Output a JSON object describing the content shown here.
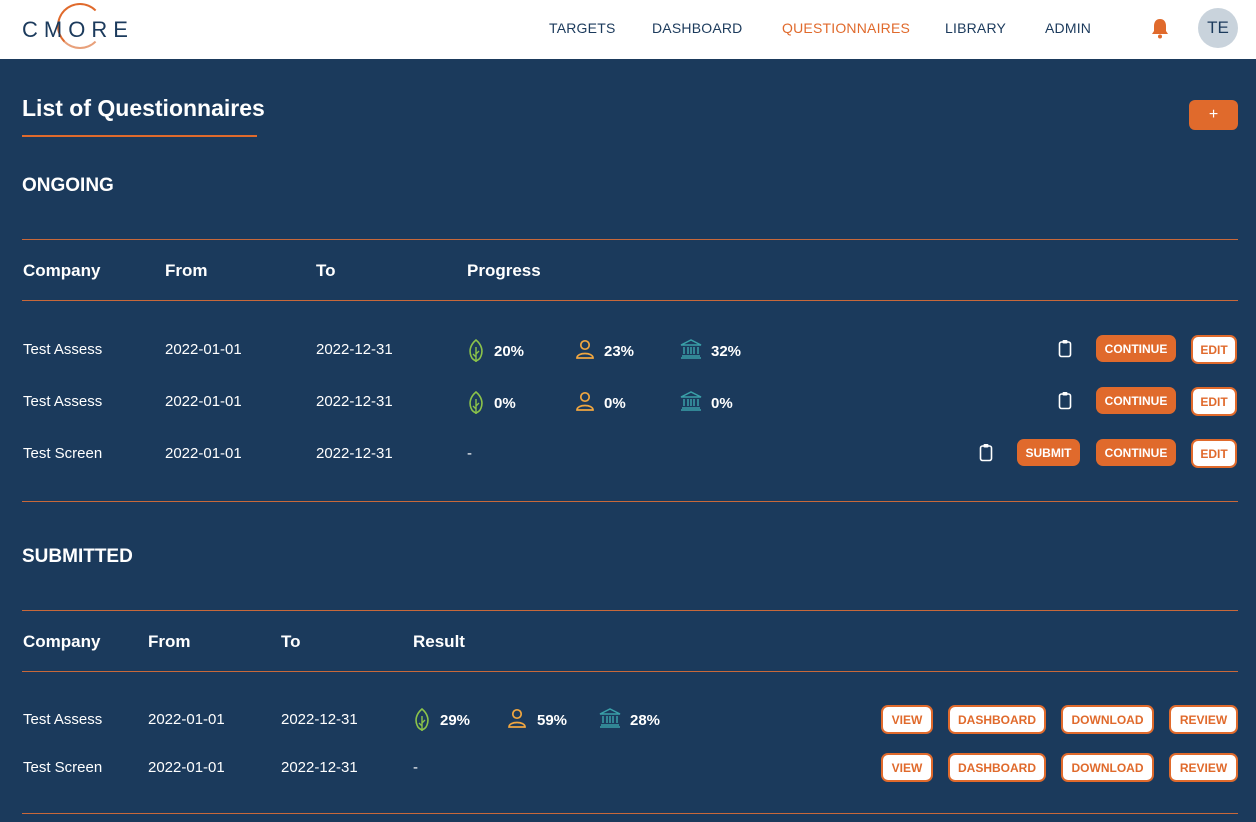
{
  "header": {
    "logo_text": "CMORE",
    "nav": [
      "TARGETS",
      "DASHBOARD",
      "QUESTIONNAIRES",
      "LIBRARY",
      "ADMIN"
    ],
    "active_nav": "QUESTIONNAIRES",
    "avatar_initials": "TE"
  },
  "page": {
    "title": "List of Questionnaires",
    "add_label": "+"
  },
  "ongoing": {
    "title": "ONGOING",
    "headers": {
      "company": "Company",
      "from": "From",
      "to": "To",
      "progress": "Progress"
    },
    "rows": [
      {
        "company": "Test Assess",
        "from": "2022-01-01",
        "to": "2022-12-31",
        "env": "20%",
        "social": "23%",
        "gov": "32%",
        "dash": ""
      },
      {
        "company": "Test Assess",
        "from": "2022-01-01",
        "to": "2022-12-31",
        "env": "0%",
        "social": "0%",
        "gov": "0%",
        "dash": ""
      },
      {
        "company": "Test Screen",
        "from": "2022-01-01",
        "to": "2022-12-31",
        "dash": "-"
      }
    ],
    "buttons": {
      "submit": "SUBMIT",
      "continue": "CONTINUE",
      "edit": "EDIT"
    }
  },
  "submitted": {
    "title": "SUBMITTED",
    "headers": {
      "company": "Company",
      "from": "From",
      "to": "To",
      "result": "Result"
    },
    "rows": [
      {
        "company": "Test Assess",
        "from": "2022-01-01",
        "to": "2022-12-31",
        "env": "29%",
        "social": "59%",
        "gov": "28%"
      },
      {
        "company": "Test Screen",
        "from": "2022-01-01",
        "to": "2022-12-31",
        "dash": "-"
      }
    ],
    "buttons": {
      "view": "VIEW",
      "dashboard": "DASHBOARD",
      "download": "DOWNLOAD",
      "review": "REVIEW"
    }
  },
  "colors": {
    "background": "#1b3a5c",
    "accent": "#e06a2c",
    "env_icon": "#8bc34a",
    "social_icon": "#f0a640",
    "gov_icon": "#3aa0a8"
  }
}
